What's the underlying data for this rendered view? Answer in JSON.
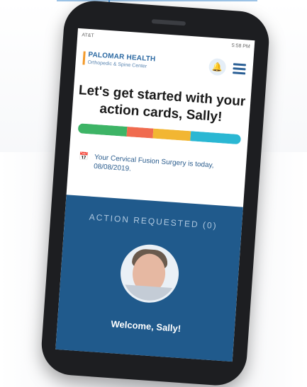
{
  "statusbar": {
    "carrier": "AT&T",
    "right": "5:58 PM"
  },
  "brand": {
    "title": "PALOMAR HEALTH",
    "subtitle": "Orthopedic & Spine Center"
  },
  "heading": "Let's get started with your action cards, Sally!",
  "progress_colors": [
    "#3db466",
    "#f06b4f",
    "#f2b632",
    "#2ab7d3"
  ],
  "notice": "Your Cervical Fusion Surgery is today, 08/08/2019.",
  "action": {
    "title": "ACTION REQUESTED (0)",
    "welcome": "Welcome, Sally!"
  }
}
